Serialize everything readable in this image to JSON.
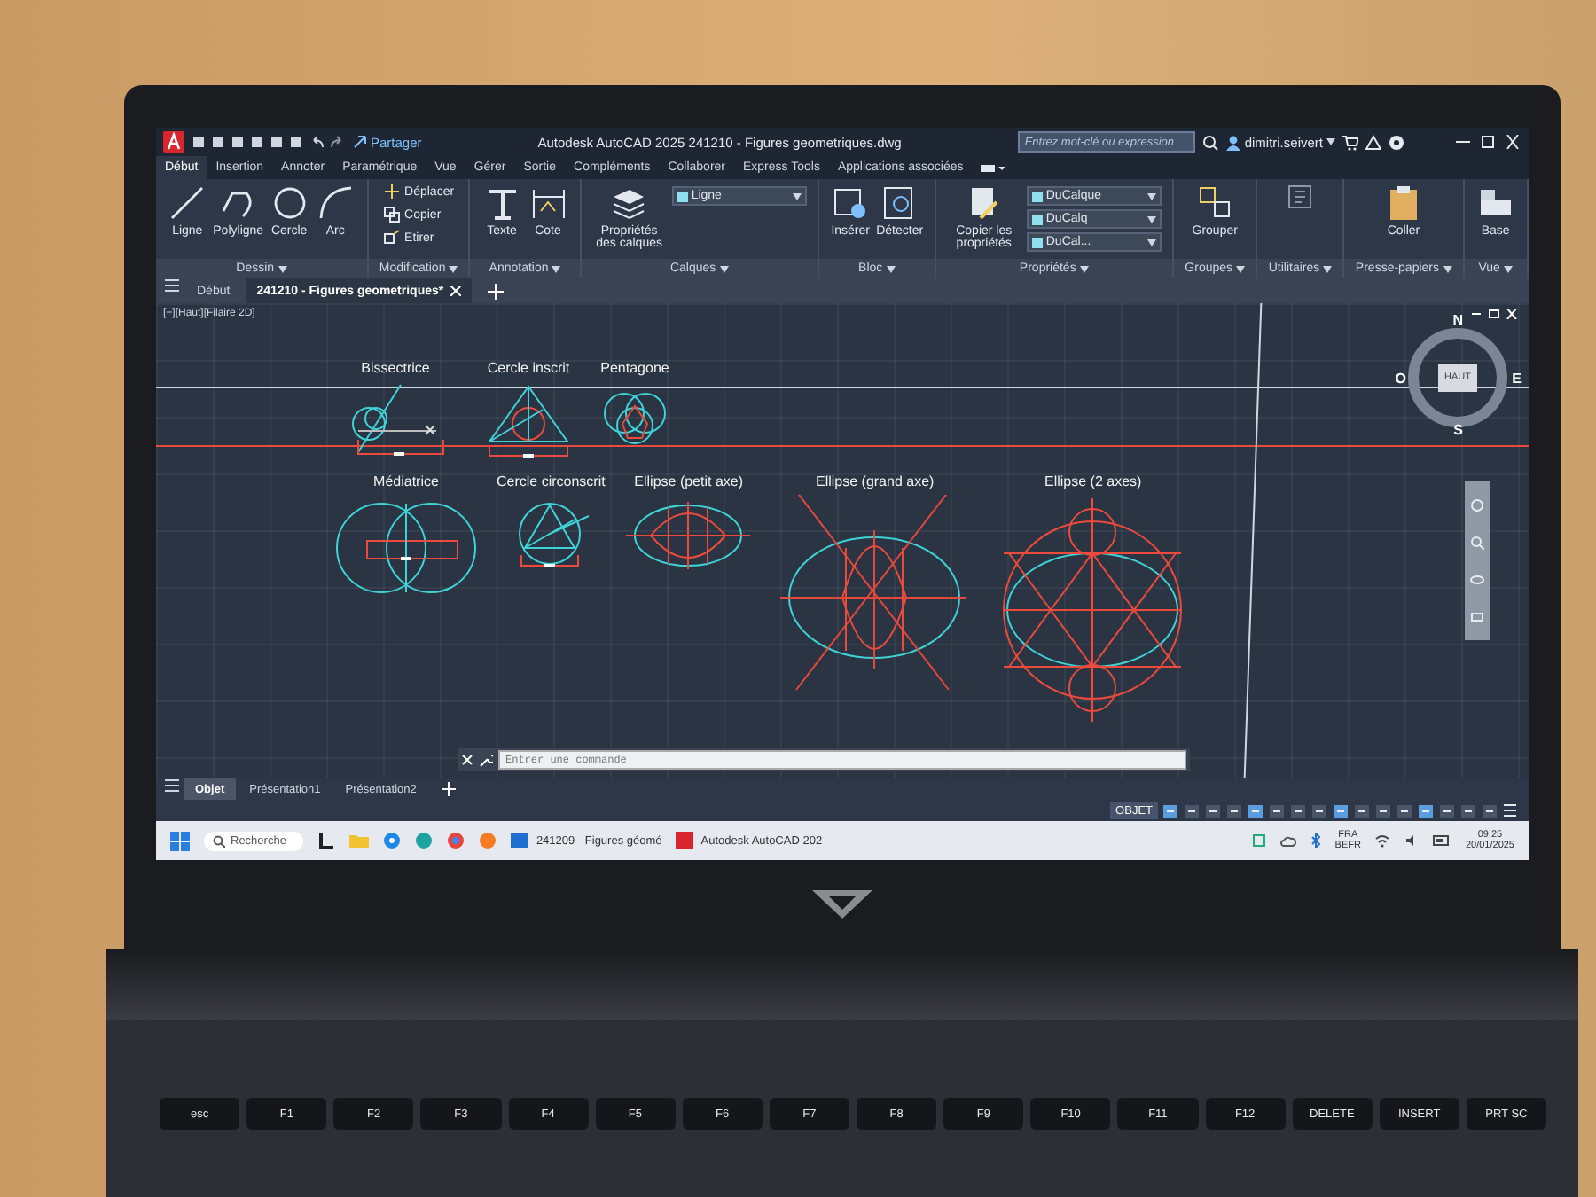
{
  "title_bar": {
    "share": "Partager",
    "title": "Autodesk AutoCAD 2025   241210 - Figures geometriques.dwg",
    "search_placeholder": "Entrez mot-clé ou expression",
    "user": "dimitri.seivert"
  },
  "ribbon_tabs": [
    {
      "label": "Début",
      "selected": true
    },
    {
      "label": "Insertion",
      "selected": false
    },
    {
      "label": "Annoter",
      "selected": false
    },
    {
      "label": "Paramétrique",
      "selected": false
    },
    {
      "label": "Vue",
      "selected": false
    },
    {
      "label": "Gérer",
      "selected": false
    },
    {
      "label": "Sortie",
      "selected": false
    },
    {
      "label": "Compléments",
      "selected": false
    },
    {
      "label": "Collaborer",
      "selected": false
    },
    {
      "label": "Express Tools",
      "selected": false
    },
    {
      "label": "Applications associées",
      "selected": false
    }
  ],
  "ribbon_panels": [
    {
      "title": "Dessin",
      "tools": [
        {
          "label": "Ligne",
          "kind": "large"
        },
        {
          "label": "Polyligne",
          "kind": "large"
        },
        {
          "label": "Cercle",
          "kind": "large"
        },
        {
          "label": "Arc",
          "kind": "large"
        }
      ]
    },
    {
      "title": "Modification",
      "tools": [
        {
          "label": "Déplacer",
          "kind": "small"
        },
        {
          "label": "Copier",
          "kind": "small"
        },
        {
          "label": "Etirer",
          "kind": "small"
        }
      ]
    },
    {
      "title": "Annotation",
      "tools": [
        {
          "label": "Texte",
          "kind": "large"
        },
        {
          "label": "Cote",
          "kind": "large"
        }
      ]
    },
    {
      "title": "Calques",
      "tools": [
        {
          "label": "Propriétés des calques",
          "kind": "large"
        },
        {
          "label": "Ligne",
          "kind": "dropdown"
        }
      ]
    },
    {
      "title": "Bloc",
      "tools": [
        {
          "label": "Insérer",
          "kind": "large"
        },
        {
          "label": "Détecter",
          "kind": "large"
        }
      ]
    },
    {
      "title": "Propriétés",
      "tools": [
        {
          "label": "Copier les propriétés",
          "kind": "large"
        },
        {
          "label": "DuCalque",
          "kind": "dropdown"
        },
        {
          "label": "DuCalq",
          "kind": "dropdown"
        },
        {
          "label": "DuCal...",
          "kind": "dropdown"
        }
      ]
    },
    {
      "title": "Groupes",
      "tools": [
        {
          "label": "Grouper",
          "kind": "large"
        }
      ]
    },
    {
      "title": "Utilitaires"
    },
    {
      "title": "Presse-papiers",
      "tools": [
        {
          "label": "Coller",
          "kind": "large"
        }
      ]
    },
    {
      "title": "Vue",
      "tools": [
        {
          "label": "Base",
          "kind": "large"
        }
      ]
    }
  ],
  "file_tabs": [
    {
      "label": "Début",
      "selected": false
    },
    {
      "label": "241210 - Figures geometriques*",
      "selected": true
    }
  ],
  "viewport": {
    "label": "[−][Haut][Filaire 2D]",
    "viewcube": {
      "top": "HAUT",
      "north": "N",
      "east": "E",
      "south": "S",
      "west": "O"
    },
    "figures_top": [
      {
        "label": "Bissectrice",
        "kind": "bisector"
      },
      {
        "label": "Cercle inscrit",
        "kind": "inscribed"
      },
      {
        "label": "Pentagone",
        "kind": "pentagon"
      }
    ],
    "figures_bottom": [
      {
        "label": "Médiatrice",
        "kind": "perpendicular"
      },
      {
        "label": "Cercle circonscrit",
        "kind": "circumscribed"
      },
      {
        "label": "Ellipse (petit axe)",
        "kind": "ellipse_minor"
      },
      {
        "label": "Ellipse (grand axe)",
        "kind": "ellipse_major"
      },
      {
        "label": "Ellipse (2 axes)",
        "kind": "ellipse_two"
      }
    ]
  },
  "command_line": {
    "placeholder": "Entrer une commande"
  },
  "layout_tabs": [
    {
      "label": "Objet",
      "selected": true
    },
    {
      "label": "Présentation1",
      "selected": false
    },
    {
      "label": "Présentation2",
      "selected": false
    }
  ],
  "status_bar": {
    "mode": "OBJET"
  },
  "taskbar": {
    "search": "Recherche",
    "windows": [
      {
        "label": "241209 - Figures géomé"
      },
      {
        "label": "Autodesk AutoCAD 202"
      }
    ],
    "language": "FRA",
    "layout": "BEFR",
    "time": "09:25",
    "date": "20/01/2025"
  },
  "keyboard": {
    "keys": [
      "esc",
      "F1",
      "F2",
      "F3",
      "F4",
      "F5",
      "F6",
      "F7",
      "F8",
      "F9",
      "F10",
      "F11",
      "F12",
      "DELETE",
      "INSERT",
      "PRT SC"
    ]
  }
}
